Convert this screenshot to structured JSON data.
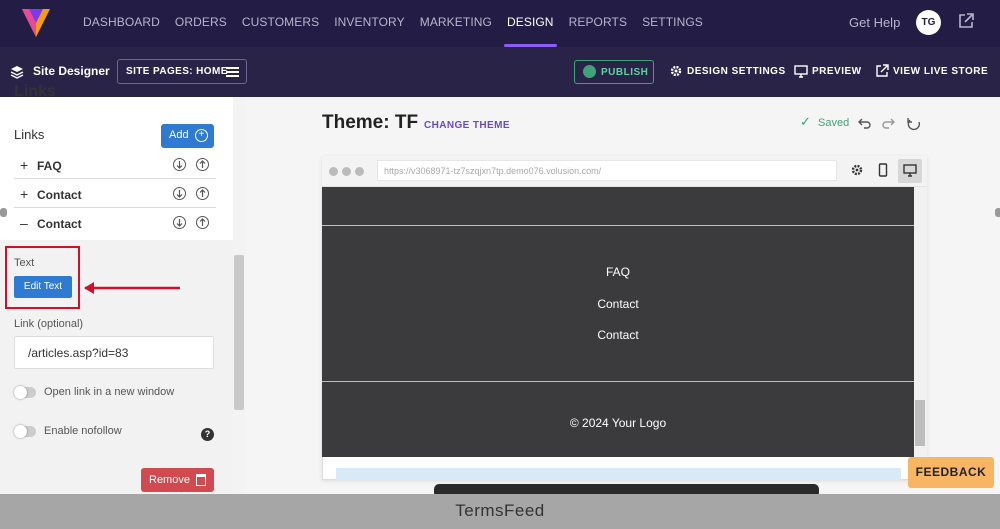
{
  "topnav": {
    "items": [
      "DASHBOARD",
      "ORDERS",
      "CUSTOMERS",
      "INVENTORY",
      "MARKETING",
      "DESIGN",
      "REPORTS",
      "SETTINGS"
    ],
    "active": "DESIGN",
    "help": "Get Help",
    "avatar": "TG"
  },
  "subbar": {
    "site_designer": "Site Designer",
    "site_pages": "SITE PAGES: HOME",
    "publish": "PUBLISH",
    "design_settings": "DESIGN SETTINGS",
    "preview": "PREVIEW",
    "view_live": "VIEW LIVE STORE"
  },
  "panel": {
    "title_cut": "Links",
    "links_heading": "Links",
    "add_label": "Add",
    "links": [
      {
        "sym": "+",
        "label": "FAQ"
      },
      {
        "sym": "+",
        "label": "Contact"
      },
      {
        "sym": "–",
        "label": "Contact"
      }
    ],
    "text_label": "Text",
    "edit_text": "Edit Text",
    "link_label": "Link (optional)",
    "link_value": "/articles.asp?id=83",
    "open_new": "Open link in a new window",
    "nofollow": "Enable nofollow",
    "help_q": "?",
    "remove": "Remove"
  },
  "main": {
    "theme": "Theme: TF",
    "change_theme": "CHANGE THEME",
    "saved": "Saved",
    "url": "https://v3068971-tz7szqjxn7tp.demo076.volusion.com/",
    "footer_links": [
      "FAQ",
      "Contact",
      "Contact"
    ],
    "copyright": "© 2024 Your Logo"
  },
  "feedback": "FEEDBACK",
  "termsfeed": "TermsFeed",
  "colors": {
    "nav_bg": "#231c44",
    "accent": "#8b5cf6",
    "blue": "#2f7bd1",
    "red_box": "#d0102a",
    "feedback": "#f8b664"
  }
}
